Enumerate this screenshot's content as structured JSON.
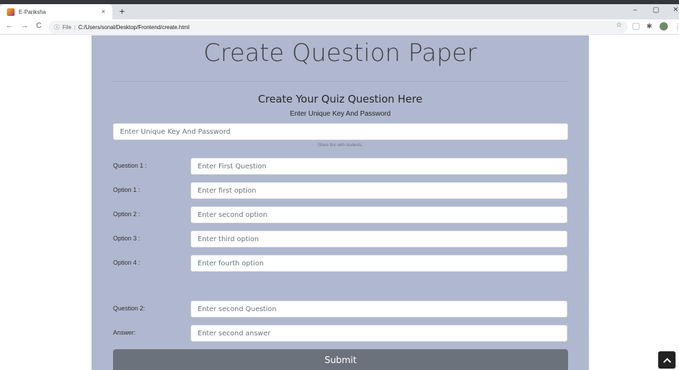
{
  "browser": {
    "tab_title": "E-Pariksha",
    "tab_close": "×",
    "new_tab": "+",
    "url_info": "ⓘ",
    "url_scheme": "File",
    "url_sep": "|",
    "url": "C:/Users/sonal/Desktop/Frontend/create.html",
    "back": "←",
    "forward": "→",
    "reload": "C",
    "star": "☆",
    "minimize": "–",
    "maximize": "▢",
    "close": "✕",
    "menu": "⋮"
  },
  "page": {
    "title": "Create Question Paper",
    "subtitle": "Create Your Quiz Question Here",
    "key_label": "Enter Unique Key And Password",
    "key_placeholder": "Enter Unique Key And Password",
    "key_hint": "Share this with students.",
    "rows": [
      {
        "label": "Question 1 :",
        "placeholder": "Enter First Question"
      },
      {
        "label": "Option 1 :",
        "placeholder": "Enter first option"
      },
      {
        "label": "Option 2 :",
        "placeholder": "Enter second option"
      },
      {
        "label": "Option 3 :",
        "placeholder": "Enter third option"
      },
      {
        "label": "Option 4 :",
        "placeholder": "Enter fourth option"
      },
      {
        "label": "Question 2:",
        "placeholder": "Enter second Question"
      },
      {
        "label": "Answer:",
        "placeholder": "Enter second answer"
      }
    ],
    "submit_label": "Submit",
    "scroll_top_icon": "^"
  },
  "colors": {
    "panel_bg": "#b0b8cf",
    "submit_bg": "#6c727c",
    "scroll_top_bg": "#222222"
  }
}
